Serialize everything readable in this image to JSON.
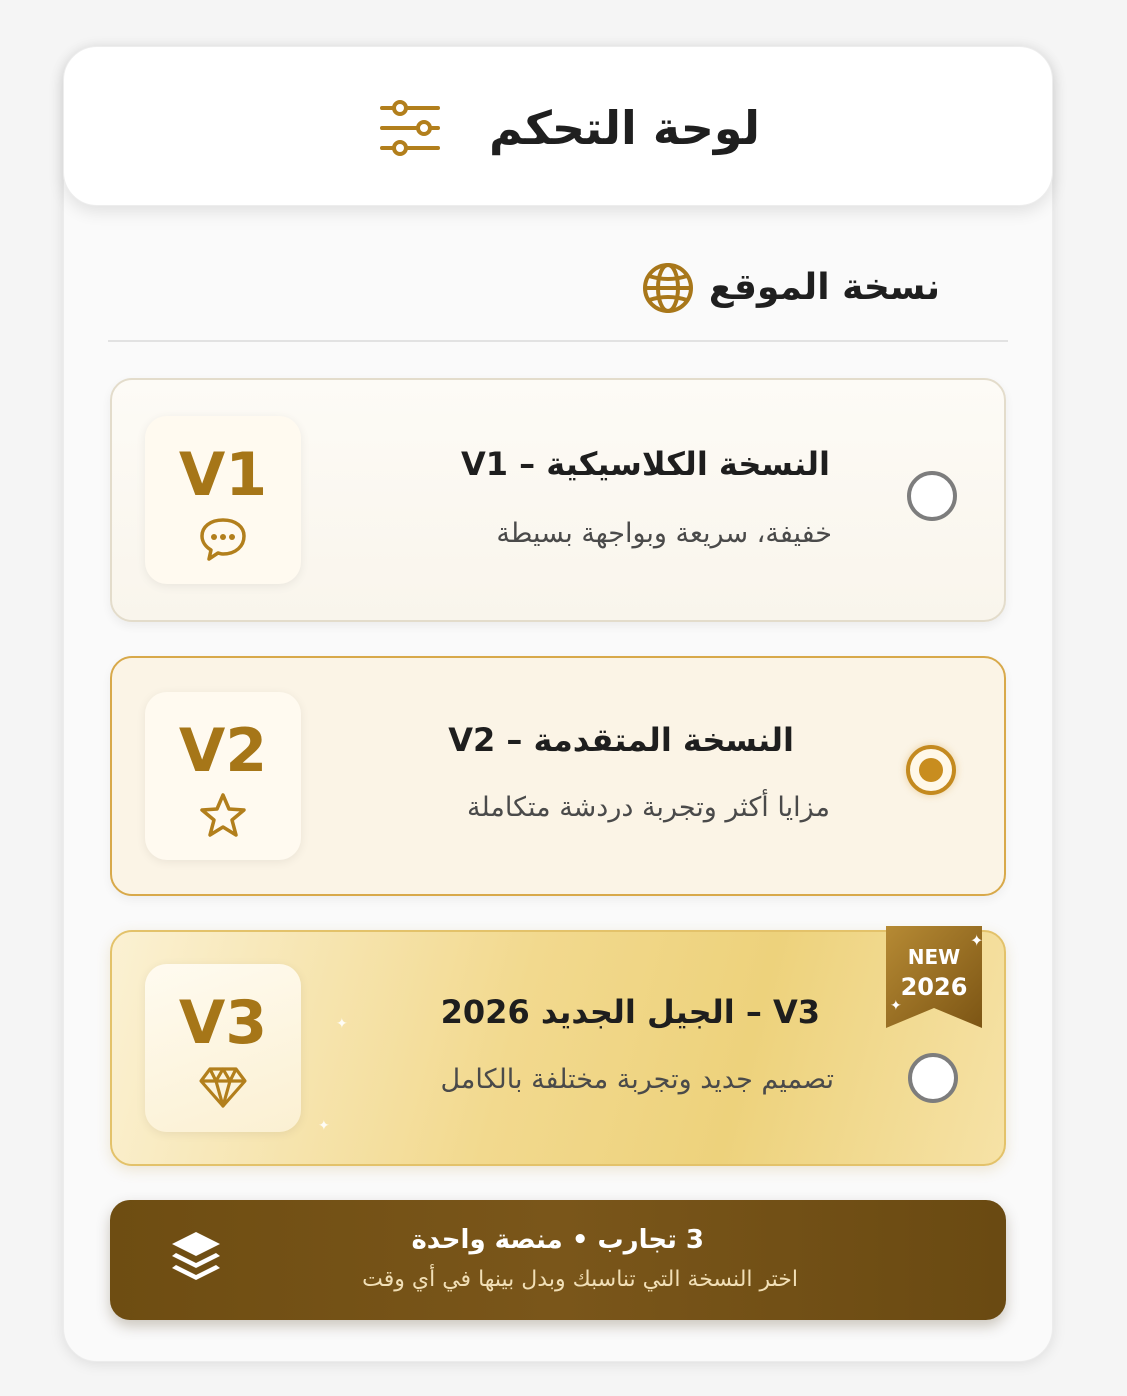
{
  "header": {
    "title": "لوحة التحكم",
    "icon": "sliders-icon"
  },
  "section": {
    "title": "نسخة الموقع",
    "icon": "globe-icon"
  },
  "options": [
    {
      "badge": "V1",
      "badge_icon": "chat-bubble-icon",
      "title": "النسخة الكلاسيكية – V1",
      "description": "خفيفة، سريعة وبواجهة بسيطة",
      "selected": false
    },
    {
      "badge": "V2",
      "badge_icon": "star-icon",
      "title": "النسخة المتقدمة – V2",
      "description": "مزايا أكثر وتجربة دردشة متكاملة",
      "selected": true
    },
    {
      "badge": "V3",
      "badge_icon": "diamond-icon",
      "title": "V3 – الجيل الجديد 2026",
      "description": "تصميم جديد وتجربة مختلفة بالكامل",
      "selected": false,
      "ribbon": {
        "line1": "NEW",
        "line2": "2026"
      }
    }
  ],
  "banner": {
    "title": "3 تجارب • منصة واحدة",
    "subtitle": "اختر النسخة التي تناسبك وبدل بينها في أي وقت",
    "icon": "layers-icon"
  },
  "colors": {
    "accent": "#b8841f",
    "banner": "#6e4d12",
    "selected_border": "#d8a94a"
  }
}
